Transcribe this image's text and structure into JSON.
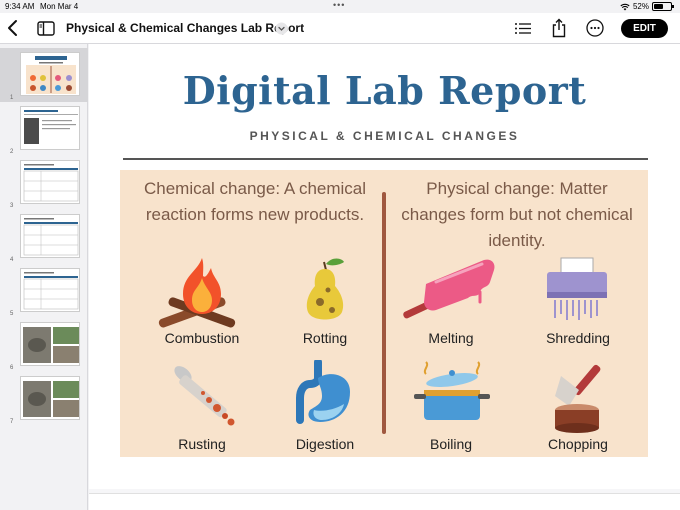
{
  "status": {
    "time": "9:34 AM",
    "date": "Mon Mar 4",
    "battery": "52%"
  },
  "toolbar": {
    "title": "Physical & Chemical Changes Lab Report",
    "edit_label": "EDIT"
  },
  "sidebar": {
    "slides": [
      {
        "number": "1"
      },
      {
        "number": "2"
      },
      {
        "number": "3"
      },
      {
        "number": "4"
      },
      {
        "number": "5"
      },
      {
        "number": "6"
      },
      {
        "number": "7"
      }
    ]
  },
  "slide": {
    "title": "Digital Lab Report",
    "subtitle": "PHYSICAL & CHEMICAL CHANGES",
    "chemical_heading": "Chemical change: A chemical reaction forms new products.",
    "physical_heading": "Physical change: Matter changes form but not chemical identity.",
    "items": {
      "combustion": "Combustion",
      "rotting": "Rotting",
      "rusting": "Rusting",
      "digestion": "Digestion",
      "melting": "Melting",
      "shredding": "Shredding",
      "boiling": "Boiling",
      "chopping": "Chopping"
    }
  },
  "colors": {
    "title_blue": "#2d6491",
    "panel_bg": "#f8e3cc",
    "divider": "#a0583f",
    "edit_button": "#000000"
  }
}
